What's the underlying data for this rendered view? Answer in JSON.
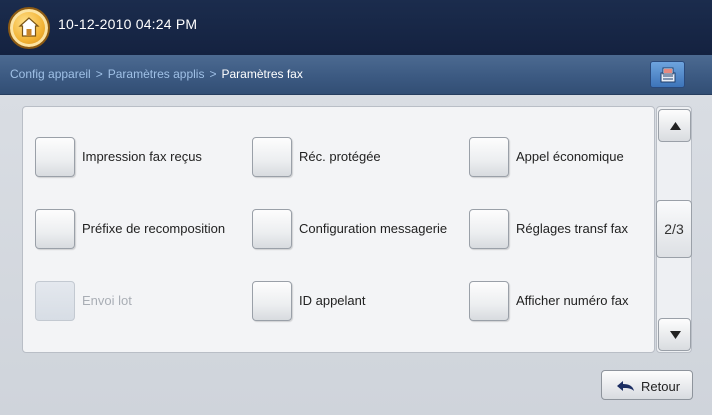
{
  "header": {
    "datetime": "10-12-2010 04:24 PM",
    "home_icon": "home-icon"
  },
  "breadcrumb": {
    "items": [
      "Config appareil",
      "Paramètres applis"
    ],
    "separator": ">",
    "current": "Paramètres fax"
  },
  "job_status_icon": "job-status-icon",
  "options": [
    {
      "label": "Impression fax reçus",
      "enabled": true
    },
    {
      "label": "Réc. protégée",
      "enabled": true
    },
    {
      "label": "Appel économique",
      "enabled": true
    },
    {
      "label": "Préfixe de recomposition",
      "enabled": true
    },
    {
      "label": "Configuration messagerie",
      "enabled": true
    },
    {
      "label": "Réglages transf fax",
      "enabled": true
    },
    {
      "label": "Envoi lot",
      "enabled": false
    },
    {
      "label": "ID appelant",
      "enabled": true
    },
    {
      "label": "Afficher numéro fax",
      "enabled": true
    }
  ],
  "pager": {
    "indicator": "2/3",
    "up_icon": "arrow-up-icon",
    "down_icon": "arrow-down-icon"
  },
  "footer": {
    "back_label": "Retour",
    "back_icon": "undo-arrow-icon"
  },
  "colors": {
    "topbar": "#142240",
    "breadcrumb_bar": "#3c5a82",
    "breadcrumb_link": "#9fc0e6",
    "disabled_text": "#a9aeb5"
  }
}
